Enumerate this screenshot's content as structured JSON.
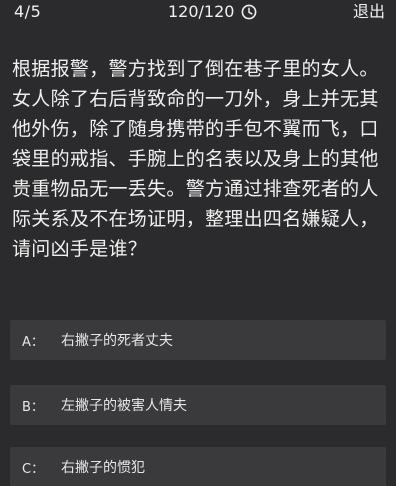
{
  "header": {
    "progress": "4/5",
    "timer": "120/120",
    "timer_icon": "clock-icon",
    "exit_label": "退出"
  },
  "question": {
    "text": "根据报警，警方找到了倒在巷子里的女人。女人除了右后背致命的一刀外，身上并无其他外伤，除了随身携带的手包不翼而飞，口袋里的戒指、手腕上的名表以及身上的其他贵重物品无一丢失。警方通过排查死者的人际关系及不在场证明，整理出四名嫌疑人，请问凶手是谁？"
  },
  "options": [
    {
      "letter": "A：",
      "text": "右撇子的死者丈夫"
    },
    {
      "letter": "B：",
      "text": "左撇子的被害人情夫"
    },
    {
      "letter": "C：",
      "text": "右撇子的惯犯"
    }
  ]
}
